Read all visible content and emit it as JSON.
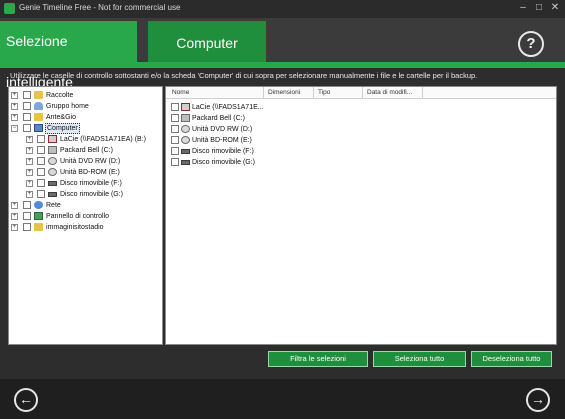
{
  "window": {
    "title": "Genie Timeline Free - Not for commercial use",
    "minimize_glyph": "–",
    "maximize_glyph": "□",
    "close_glyph": "✕"
  },
  "tabs": [
    {
      "label": "Selezione intelligente",
      "state": "inactive"
    },
    {
      "label": "Computer",
      "state": "active"
    }
  ],
  "help_glyph": "?",
  "instructions": "Utilizzare le caselle di controllo sottostanti e/o la scheda 'Computer' di cui sopra per selezionare manualmente i file e le cartelle per il backup.",
  "tree": {
    "items": [
      {
        "label": "Raccolte",
        "icon": "library-folder-icon",
        "level": 0
      },
      {
        "label": "Gruppo home",
        "icon": "homegroup-icon",
        "level": 0
      },
      {
        "label": "Ante&Gio",
        "icon": "user-folder-icon",
        "level": 0
      },
      {
        "label": "Computer",
        "icon": "computer-icon",
        "level": 0,
        "selected": true
      },
      {
        "label": "LaCie (\\\\FADS1A71EA) (B:)",
        "icon": "network-drive-icon",
        "level": 1
      },
      {
        "label": "Packard Bell (C:)",
        "icon": "hard-drive-icon",
        "level": 1
      },
      {
        "label": "Unità DVD RW (D:)",
        "icon": "dvd-drive-icon",
        "level": 1
      },
      {
        "label": "Unità BD-ROM (E:)",
        "icon": "bd-drive-icon",
        "level": 1
      },
      {
        "label": "Disco rimovibile (F:)",
        "icon": "removable-disk-icon",
        "level": 1
      },
      {
        "label": "Disco rimovibile (G:)",
        "icon": "removable-disk-icon",
        "level": 1
      },
      {
        "label": "Rete",
        "icon": "network-icon",
        "level": 0
      },
      {
        "label": "Pannello di controllo",
        "icon": "control-panel-icon",
        "level": 0
      },
      {
        "label": "immaginisitostadio",
        "icon": "folder-icon",
        "level": 0
      }
    ]
  },
  "list": {
    "columns": [
      "Nome",
      "Dimensioni",
      "Tipo",
      "Data di modifi..."
    ],
    "rows": [
      {
        "name": "LaCie (\\\\FADS1A71E...",
        "icon": "network-drive-icon"
      },
      {
        "name": "Packard Bell (C:)",
        "icon": "hard-drive-icon"
      },
      {
        "name": "Unità DVD RW (D:)",
        "icon": "dvd-drive-icon"
      },
      {
        "name": "Unità BD-ROM (E:)",
        "icon": "bd-drive-icon"
      },
      {
        "name": "Disco rimovibile (F:)",
        "icon": "removable-disk-icon"
      },
      {
        "name": "Disco rimovibile (G:)",
        "icon": "removable-disk-icon"
      }
    ]
  },
  "buttons": {
    "filter": "Filtra le selezioni",
    "select_all": "Seleziona tutto",
    "deselect_all": "Deseleziona tutto"
  },
  "nav": {
    "back_glyph": "←",
    "forward_glyph": "→"
  },
  "colors": {
    "accent": "#29a84b",
    "accent_dark": "#1f8f3d",
    "background": "#2d2d2d",
    "bottom_bar": "#1f1f1f"
  }
}
